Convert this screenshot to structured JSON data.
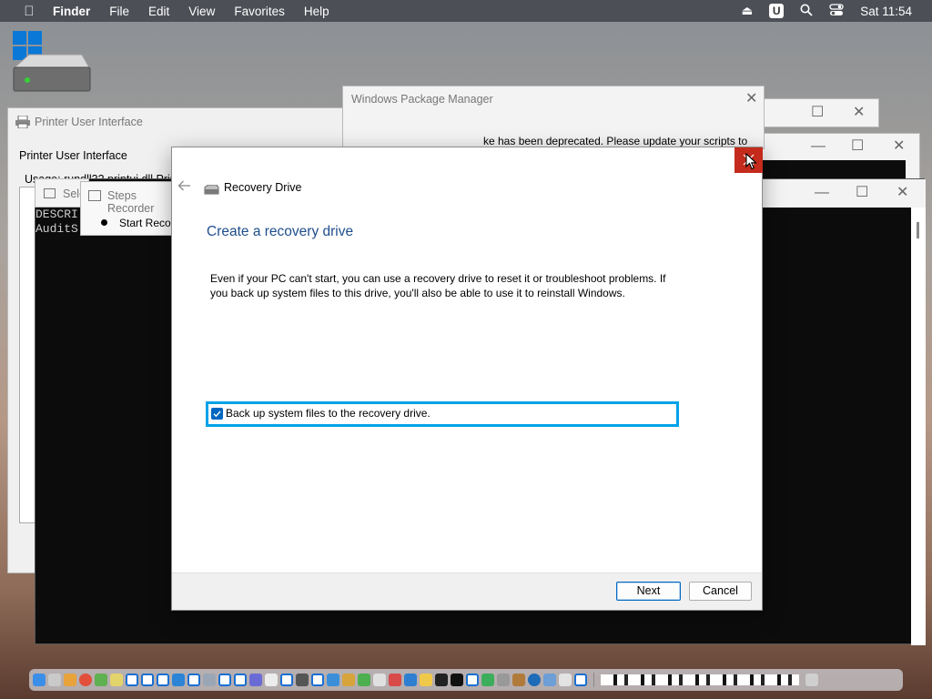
{
  "menubar": {
    "app_name": "Finder",
    "items": [
      "File",
      "Edit",
      "View",
      "Favorites",
      "Help"
    ],
    "clock": "Sat 11:54",
    "user_badge": "U"
  },
  "bg_windows": {
    "printer_title": "Printer User Interface",
    "printer_heading": "Printer User Interface",
    "printer_usage": "Usage: rundll32 printui.dll,PrintUI",
    "select_title": "Sele",
    "steps_title": "Steps Recorder",
    "steps_start": "Start Recor",
    "console_lines": [
      "DESCRI",
      "AuditS"
    ],
    "wpm_title": "Windows Package Manager",
    "wpm_message": "ke has been deprecated. Please update your scripts to"
  },
  "dialog": {
    "app_title": "Recovery Drive",
    "heading": "Create a recovery drive",
    "description": "Even if your PC can't start, you can use a recovery drive to reset it or troubleshoot problems. If you back up system files to this drive, you'll also be able to use it to reinstall Windows.",
    "checkbox_label": "Back up system files to the recovery drive.",
    "checkbox_checked": true,
    "next_label": "Next",
    "cancel_label": "Cancel"
  },
  "colors": {
    "heading_blue": "#1e4e8c",
    "focus_cyan": "#00a2e8",
    "close_red": "#c42b1c",
    "check_blue": "#0067c0"
  }
}
